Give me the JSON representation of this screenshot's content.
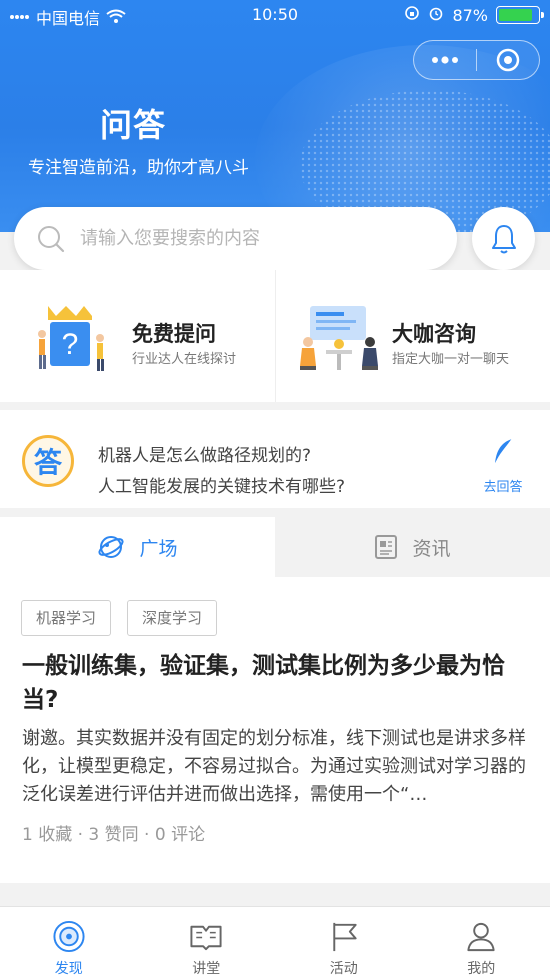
{
  "status_bar": {
    "carrier": "中国电信",
    "time": "10:50",
    "battery_percent": "87%",
    "battery_level": 0.87
  },
  "hero": {
    "title": "问答",
    "subtitle": "专注智造前沿，助你才高八斗"
  },
  "search": {
    "placeholder": "请输入您要搜索的内容"
  },
  "features": [
    {
      "title": "免费提问",
      "subtitle": "行业达人在线探讨"
    },
    {
      "title": "大咖咨询",
      "subtitle": "指定大咖一对一聊天"
    }
  ],
  "qa_prompt": {
    "badge": "答",
    "questions": [
      "机器人是怎么做路径规划的?",
      "人工智能发展的关键技术有哪些?"
    ],
    "answer_label": "去回答"
  },
  "tabs": [
    {
      "label": "广场",
      "active": true
    },
    {
      "label": "资讯",
      "active": false
    }
  ],
  "post": {
    "tags": [
      "机器学习",
      "深度学习"
    ],
    "title": "一般训练集，验证集，测试集比例为多少最为恰当?",
    "body": "谢邀。其实数据并没有固定的划分标准，线下测试也是讲求多样化，让模型更稳定，不容易过拟合。为通过实验测试对学习器的泛化误差进行评估并进而做出选择，需使用一个“…",
    "meta": "1 收藏 · 3 赞同 · 0 评论"
  },
  "bottom_nav": [
    {
      "label": "发现",
      "icon": "discover-icon",
      "active": true
    },
    {
      "label": "讲堂",
      "icon": "book-icon",
      "active": false
    },
    {
      "label": "活动",
      "icon": "flag-icon",
      "active": false
    },
    {
      "label": "我的",
      "icon": "person-icon",
      "active": false
    }
  ],
  "colors": {
    "primary": "#2d86f0",
    "badge_border": "#f6b63a",
    "battery": "#35d24f"
  }
}
